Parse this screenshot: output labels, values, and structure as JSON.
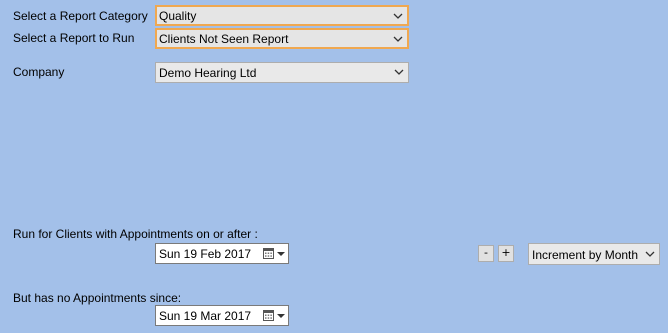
{
  "form": {
    "category_label": "Select a Report Category",
    "category_value": "Quality",
    "report_label": "Select a Report to Run",
    "report_value": "Clients Not Seen Report",
    "company_label": "Company",
    "company_value": "Demo Hearing Ltd",
    "from_label": "Run for Clients with Appointments on or after :",
    "from_date": "Sun  19 Feb 2017",
    "minus_label": "-",
    "plus_label": "+",
    "increment_value": "Increment by Month",
    "since_label": "But has no Appointments since:",
    "since_date": "Sun  19 Mar 2017"
  },
  "icons": {
    "dropdown": "chevron-down-icon",
    "calendar": "calendar-icon"
  },
  "colors": {
    "background": "#a3c0e9",
    "highlight_border": "#f0a850"
  }
}
